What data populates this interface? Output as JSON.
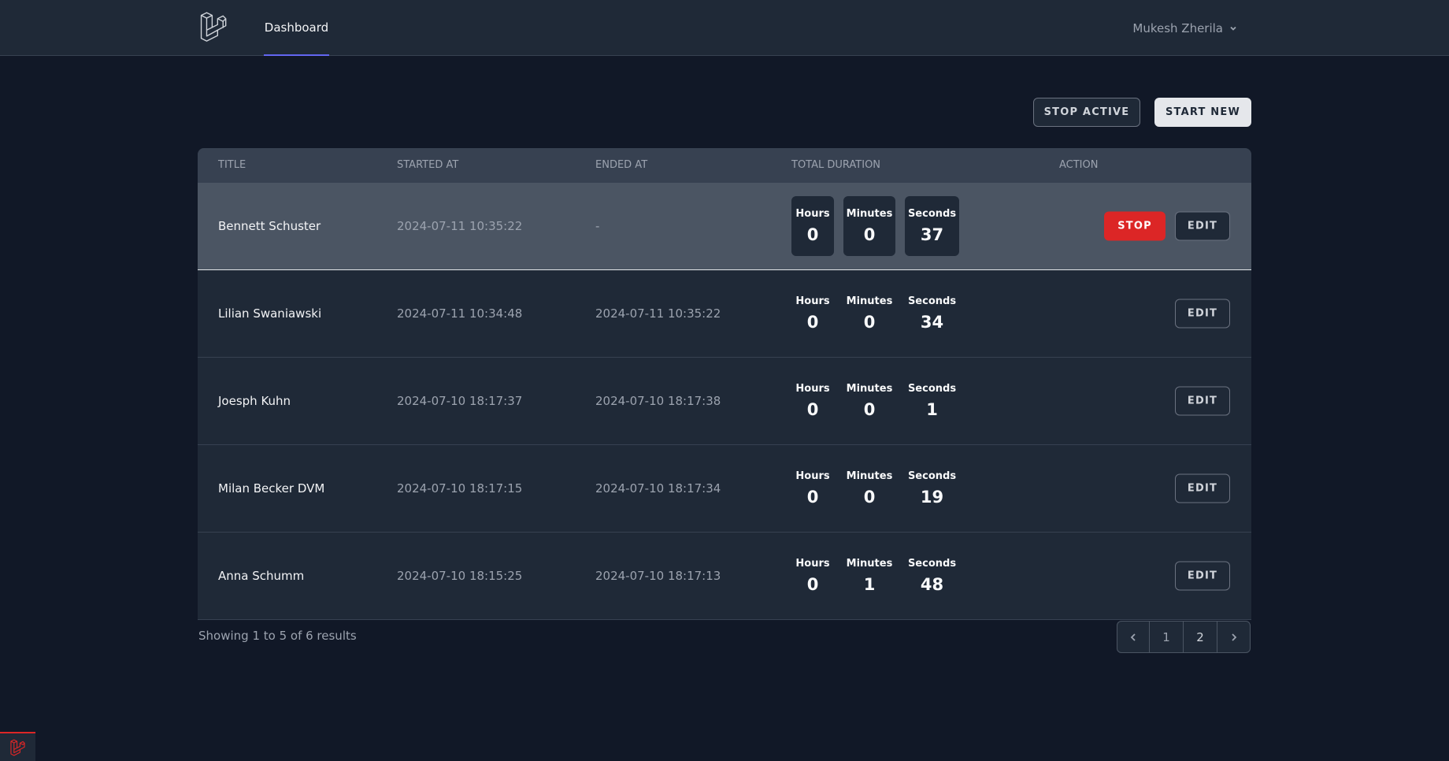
{
  "nav": {
    "logo_icon": "laravel-logo-icon",
    "links": [
      {
        "label": "Dashboard"
      }
    ],
    "user_name": "Mukesh Zherila",
    "user_chevron_icon": "chevron-down-icon"
  },
  "actions": {
    "stop_active_label": "STOP ACTIVE",
    "start_new_label": "START NEW"
  },
  "table": {
    "headers": [
      "TITLE",
      "STARTED AT",
      "ENDED AT",
      "TOTAL DURATION",
      "ACTION"
    ],
    "duration_labels": {
      "hours": "Hours",
      "minutes": "Minutes",
      "seconds": "Seconds"
    },
    "stop_label": "STOP",
    "edit_label": "EDIT",
    "rows": [
      {
        "title": "Bennett Schuster",
        "started_at": "2024-07-11 10:35:22",
        "ended_at": "-",
        "hours": "0",
        "minutes": "0",
        "seconds": "37",
        "active": true
      },
      {
        "title": "Lilian Swaniawski",
        "started_at": "2024-07-11 10:34:48",
        "ended_at": "2024-07-11 10:35:22",
        "hours": "0",
        "minutes": "0",
        "seconds": "34",
        "active": false
      },
      {
        "title": "Joesph Kuhn",
        "started_at": "2024-07-10 18:17:37",
        "ended_at": "2024-07-10 18:17:38",
        "hours": "0",
        "minutes": "0",
        "seconds": "1",
        "active": false
      },
      {
        "title": "Milan Becker DVM",
        "started_at": "2024-07-10 18:17:15",
        "ended_at": "2024-07-10 18:17:34",
        "hours": "0",
        "minutes": "0",
        "seconds": "19",
        "active": false
      },
      {
        "title": "Anna Schumm",
        "started_at": "2024-07-10 18:15:25",
        "ended_at": "2024-07-10 18:17:13",
        "hours": "0",
        "minutes": "1",
        "seconds": "48",
        "active": false
      }
    ]
  },
  "pagination": {
    "summary": "Showing 1 to 5 of 6 results",
    "pages": [
      "1",
      "2"
    ],
    "prev_icon": "chevron-left-icon",
    "next_icon": "chevron-right-icon"
  },
  "colors": {
    "background": "#111827",
    "surface": "#1f2937",
    "active_row": "#4b5563",
    "accent": "#6366f1",
    "danger": "#dc2626"
  }
}
